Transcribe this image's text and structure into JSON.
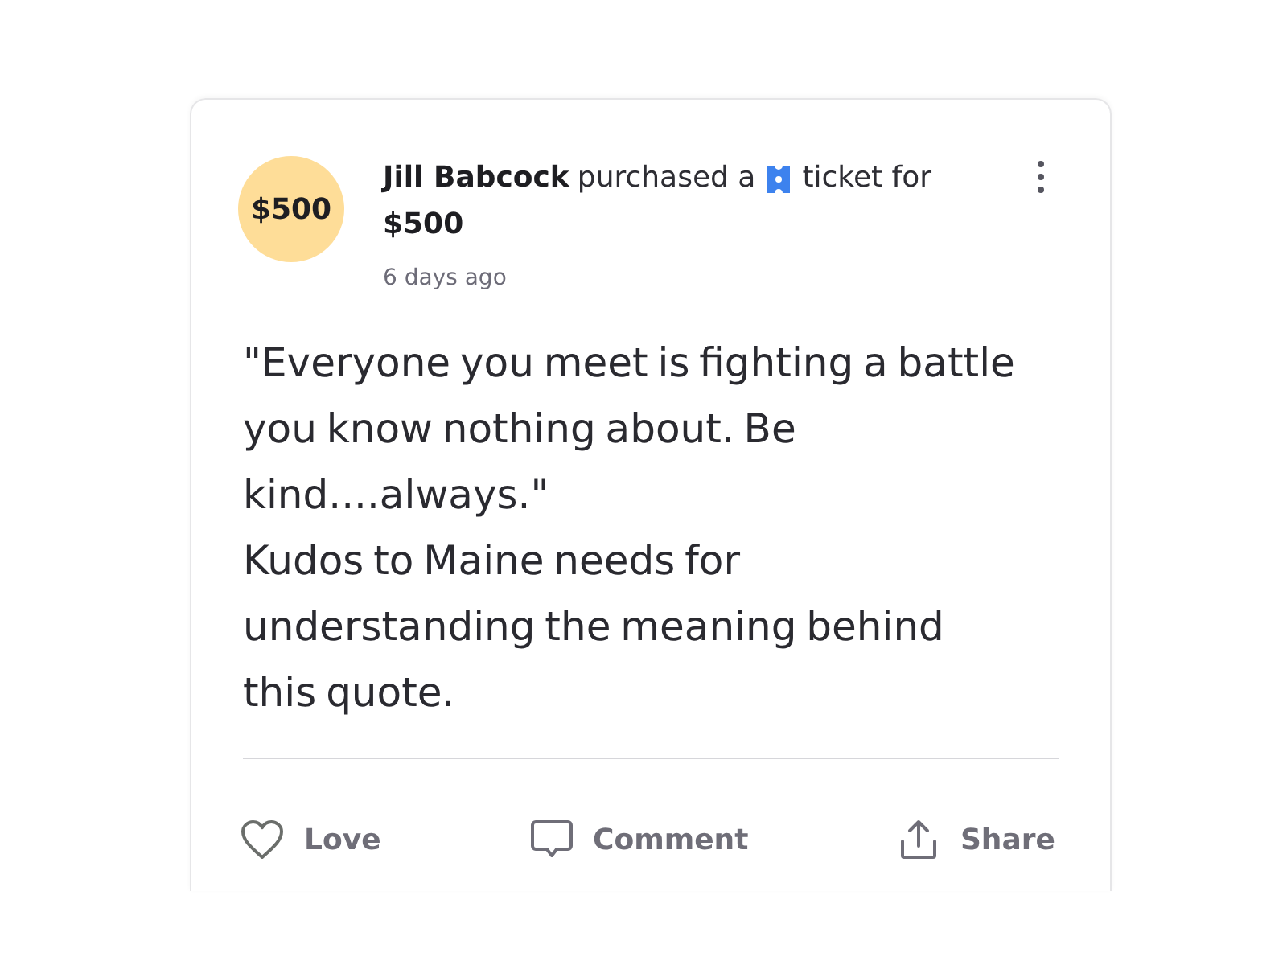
{
  "post": {
    "avatar": {
      "label": "$500"
    },
    "author": "Jill Babcock",
    "action_before": "purchased a",
    "action_after": "ticket for",
    "amount": "$500",
    "time": "6 days ago"
  },
  "body": {
    "paragraphs": [
      "\"Everyone you meet is fighting a battle you know nothing about. Be kind....always.\"",
      "Kudos to Maine needs for understanding the meaning behind this quote."
    ]
  },
  "actions": [
    {
      "kind": "love",
      "label": "Love"
    },
    {
      "kind": "comment",
      "label": "Comment"
    },
    {
      "kind": "share",
      "label": "Share"
    }
  ]
}
